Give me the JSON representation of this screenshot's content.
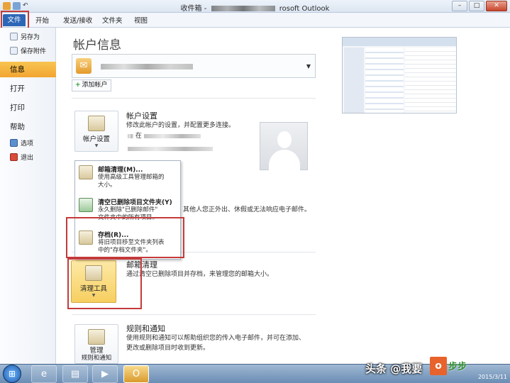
{
  "window": {
    "title_prefix": "收件箱 -",
    "title_suffix": "rosoft Outlook",
    "buttons": [
      "–",
      "□",
      "✕"
    ]
  },
  "ribbon": {
    "tabs": [
      "文件",
      "开始",
      "发送/接收",
      "文件夹",
      "视图"
    ]
  },
  "nav": {
    "save_as": "另存为",
    "save_attachments": "保存附件",
    "info": "信息",
    "open": "打开",
    "print": "打印",
    "help": "帮助",
    "options": "选项",
    "exit": "退出"
  },
  "main": {
    "title": "帐户信息",
    "add_account": "添加帐户",
    "account_settings": {
      "button": "帐户设置",
      "title": "帐户设置",
      "desc": "修改此帐户的设置，并配置更多连接。",
      "detail_prefix": "在"
    },
    "auto_reply": {
      "desc_fragment": "其他人您正外出、休假或无法响应电子邮件。"
    },
    "cleanup": {
      "button": "清理工具",
      "title": "邮箱清理",
      "desc": "通过清空已删除项目并存档，来管理您的邮箱大小。"
    },
    "rules": {
      "button_line1": "管理",
      "button_line2": "规则和通知",
      "title": "规则和通知",
      "desc_line1": "使用规则和通知可以帮助组织您的传入电子邮件，并可在添加、",
      "desc_line2": "更改或删除项目时收到更新。"
    }
  },
  "dropdown_menu": {
    "items": [
      {
        "title": "邮箱清理(M)...",
        "desc_line1": "使用高级工具管理邮箱的",
        "desc_line2": "大小。"
      },
      {
        "title": "清空已删除项目文件夹(Y)",
        "desc_line1": "永久删除\"已删除邮件\"",
        "desc_line2": "文件夹中的所有项目。"
      },
      {
        "title": "存档(R)...",
        "desc_line1": "将旧项目移至文件夹列表",
        "desc_line2": "中的\"存档文件夹\"。"
      }
    ]
  },
  "taskbar": {
    "date": "2015/3/11"
  },
  "watermark": {
    "text": "头条 @我要",
    "logo": "o",
    "site": "步步"
  },
  "colors": {
    "file_tab": "#2d66b6",
    "active_nav": "#f2a531",
    "highlight_box": "#c43a3a"
  }
}
